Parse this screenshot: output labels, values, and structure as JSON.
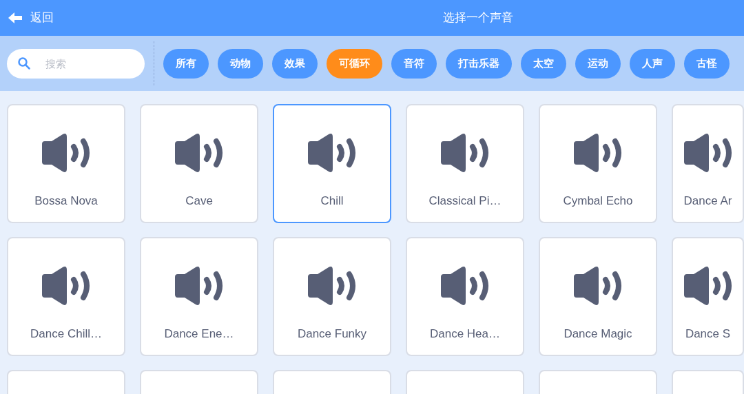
{
  "header": {
    "back": "返回",
    "title": "选择一个声音"
  },
  "search": {
    "placeholder": "搜索"
  },
  "categories": [
    {
      "label": "所有",
      "selected": false
    },
    {
      "label": "动物",
      "selected": false
    },
    {
      "label": "效果",
      "selected": false
    },
    {
      "label": "可循环",
      "selected": true
    },
    {
      "label": "音符",
      "selected": false
    },
    {
      "label": "打击乐器",
      "selected": false
    },
    {
      "label": "太空",
      "selected": false
    },
    {
      "label": "运动",
      "selected": false
    },
    {
      "label": "人声",
      "selected": false
    },
    {
      "label": "古怪",
      "selected": false
    }
  ],
  "sounds": [
    {
      "name": "Bossa Nova",
      "selected": false
    },
    {
      "name": "Cave",
      "selected": false
    },
    {
      "name": "Chill",
      "selected": true
    },
    {
      "name": "Classical Pi…",
      "selected": false
    },
    {
      "name": "Cymbal Echo",
      "selected": false
    },
    {
      "name": "Dance Ar",
      "selected": false
    },
    {
      "name": "Dance Chill…",
      "selected": false
    },
    {
      "name": "Dance Ene…",
      "selected": false
    },
    {
      "name": "Dance Funky",
      "selected": false
    },
    {
      "name": "Dance Hea…",
      "selected": false
    },
    {
      "name": "Dance Magic",
      "selected": false
    },
    {
      "name": "Dance S",
      "selected": false
    },
    {
      "selected": false
    },
    {
      "selected": false
    },
    {
      "selected": false
    },
    {
      "selected": false
    },
    {
      "selected": false
    },
    {
      "selected": false
    }
  ]
}
